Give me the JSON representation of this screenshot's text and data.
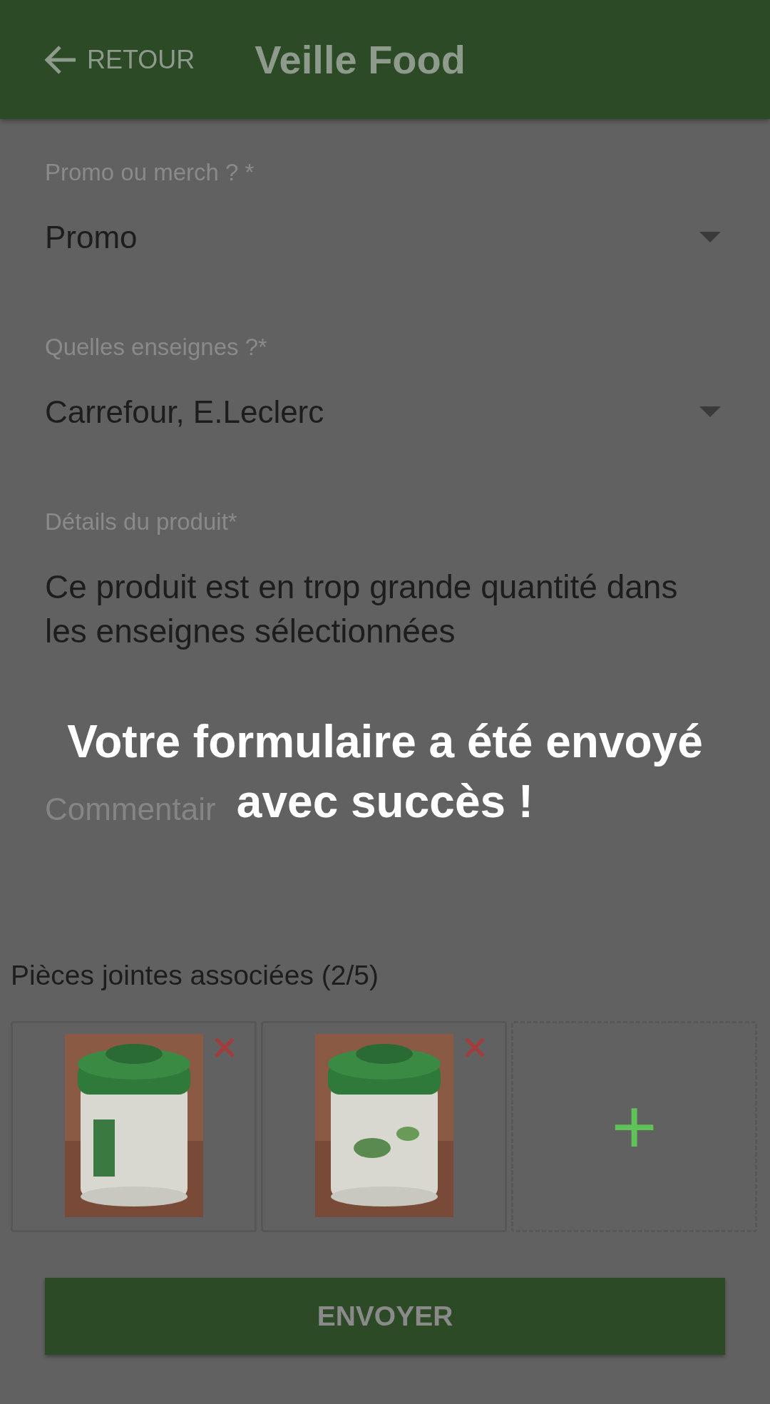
{
  "header": {
    "back_label": "RETOUR",
    "title": "Veille Food"
  },
  "fields": [
    {
      "kind": "select",
      "label": "Promo ou merch ? *",
      "value": "Promo"
    },
    {
      "kind": "select",
      "label": "Quelles enseignes ?*",
      "value": "Carrefour, E.Leclerc"
    },
    {
      "kind": "text",
      "label": "Détails du produit*",
      "value": "Ce produit est en trop grande quantité dans les enseignes sélectionnées"
    },
    {
      "kind": "input",
      "placeholder": "Commentair"
    }
  ],
  "message_lines": [
    "Votre formulaire a été envoyé",
    "avec succès !"
  ],
  "attachments": {
    "title": "Pièces jointes associées (2/5)",
    "add_label": "+"
  },
  "submit": "ENVOYER"
}
